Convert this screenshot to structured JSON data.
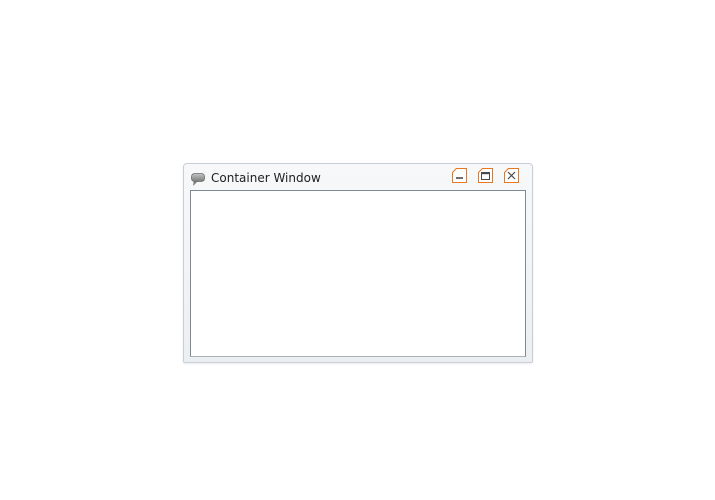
{
  "window": {
    "title": "Container Window",
    "icon": "speech-bubble-icon",
    "controls": {
      "minimize": "minimize-icon",
      "maximize": "maximize-icon",
      "close": "close-icon"
    },
    "accent_color": "#e87722",
    "background_color": "#ffffff"
  }
}
